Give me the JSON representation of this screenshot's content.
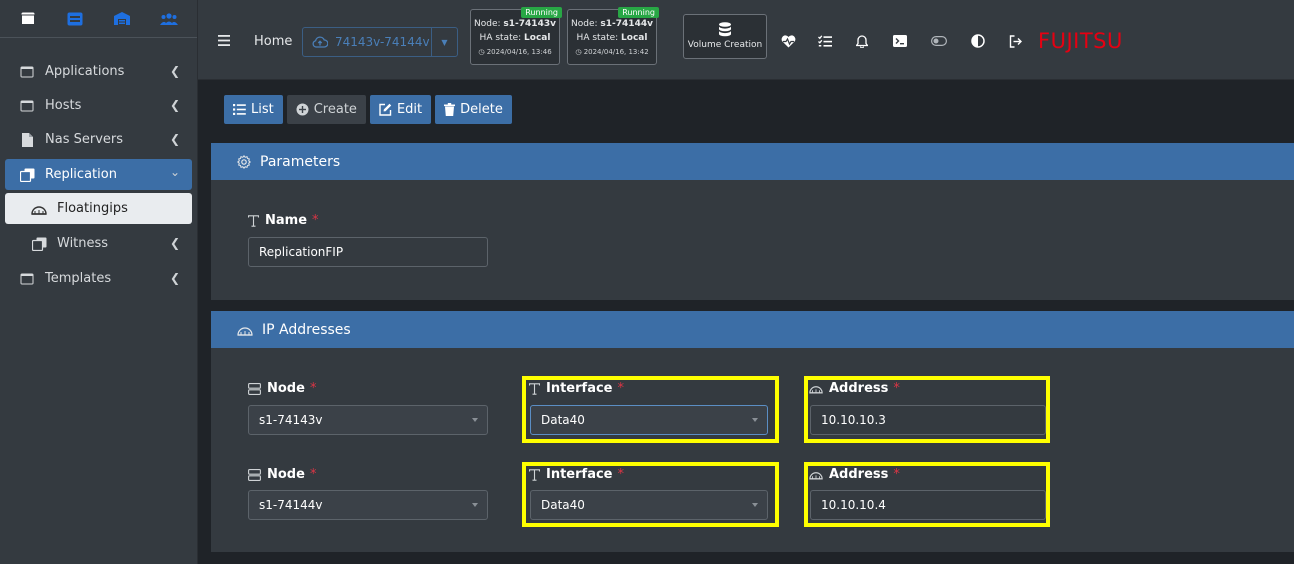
{
  "sidebar": {
    "top_icons": [
      "window-icon",
      "server-icon",
      "warehouse-icon",
      "users-icon"
    ],
    "items": [
      {
        "label": "Applications",
        "icon": "window-icon"
      },
      {
        "label": "Hosts",
        "icon": "window-icon"
      },
      {
        "label": "Nas Servers",
        "icon": "file-icon"
      },
      {
        "label": "Replication",
        "icon": "copy-icon"
      },
      {
        "label": "Floatingips",
        "icon": "network-icon"
      },
      {
        "label": "Witness",
        "icon": "copy-icon"
      },
      {
        "label": "Templates",
        "icon": "window-icon"
      }
    ]
  },
  "topbar": {
    "home_label": "Home",
    "cluster_selector": "74143v-74144v",
    "nodes": [
      {
        "running": "Running",
        "node_prefix": "Node: ",
        "node_name": "s1-74143v",
        "ha_prefix": "HA state: ",
        "ha_state": "Local",
        "timestamp": "2024/04/16, 13:46"
      },
      {
        "running": "Running",
        "node_prefix": "Node: ",
        "node_name": "s1-74144v",
        "ha_prefix": "HA state: ",
        "ha_state": "Local",
        "timestamp": "2024/04/16, 13:42"
      }
    ],
    "volume_creation_label": "Volume Creation",
    "logo": "FUJITSU"
  },
  "toolbar": {
    "list_label": "List",
    "create_label": "Create",
    "edit_label": "Edit",
    "delete_label": "Delete"
  },
  "parameters": {
    "title": "Parameters",
    "name_label": "Name",
    "name_value": "ReplicationFIP"
  },
  "ip_addresses": {
    "title": "IP Addresses",
    "rows": [
      {
        "node_label": "Node",
        "node_value": "s1-74143v",
        "interface_label": "Interface",
        "interface_value": "Data40",
        "address_label": "Address",
        "address_value": "10.10.10.3"
      },
      {
        "node_label": "Node",
        "node_value": "s1-74144v",
        "interface_label": "Interface",
        "interface_value": "Data40",
        "address_label": "Address",
        "address_value": "10.10.10.4"
      }
    ]
  },
  "colors": {
    "accent": "#3c6ea6",
    "highlight": "#ffff00",
    "running": "#28a745",
    "logo": "#e60012",
    "required": "#dc3545"
  }
}
